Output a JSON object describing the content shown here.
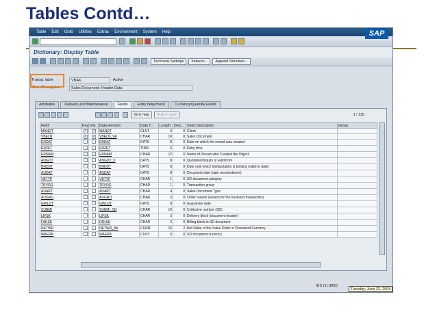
{
  "slide": {
    "title": "Tables Contd…"
  },
  "menubar": {
    "items": [
      "Table",
      "Edit",
      "Goto",
      "Utilities",
      "Extras",
      "Environment",
      "System",
      "Help"
    ],
    "logo": "SAP"
  },
  "titlebar": {
    "title": "Dictionary: Display Table"
  },
  "toolbar2": {
    "technical_settings": "Technical Settings",
    "indexes": "Indexes...",
    "append_structure": "Append Structure..."
  },
  "header": {
    "table_label": "Transp. table",
    "table_value": "VBAK",
    "status": "Active",
    "desc_label": "Short Description",
    "desc_value": "Sales Document: Header Data"
  },
  "tabs": [
    "Attributes",
    "Delivery and Maintenance",
    "Fields",
    "Entry help/check",
    "Currency/Quantity Fields"
  ],
  "active_tab": "Fields",
  "panel_toolbar": {
    "srch_help": "Srch help",
    "built_in_type": "Built-in type",
    "counter": "1 / 115"
  },
  "columns": [
    "Field",
    "Key",
    "Initi..",
    "Data element",
    "Data T...",
    "Length",
    "Deci...",
    "Short Description",
    "Group"
  ],
  "rows": [
    {
      "field": "MANDT",
      "key": true,
      "init": true,
      "de": "MANDT",
      "dtype": "CLNT",
      "len": "3",
      "dec": "0",
      "desc": "Client"
    },
    {
      "field": "VBELN",
      "key": true,
      "init": true,
      "de": "VBELN_VA",
      "dtype": "CHAR",
      "len": "10",
      "dec": "0",
      "desc": "Sales Document"
    },
    {
      "field": "ERDAT",
      "key": false,
      "init": false,
      "de": "ERDAT",
      "dtype": "DATS",
      "len": "8",
      "dec": "0",
      "desc": "Date on which the record was created"
    },
    {
      "field": "ERZET",
      "key": false,
      "init": false,
      "de": "ERZET",
      "dtype": "TIMS",
      "len": "6",
      "dec": "0",
      "desc": "Entry time"
    },
    {
      "field": "ERNAM",
      "key": false,
      "init": false,
      "de": "ERNAM",
      "dtype": "CHAR",
      "len": "12",
      "dec": "0",
      "desc": "Name of Person who Created the Object"
    },
    {
      "field": "ANGDT",
      "key": false,
      "init": false,
      "de": "ANGDT_V",
      "dtype": "DATS",
      "len": "8",
      "dec": "0",
      "desc": "Quotation/Inquiry is valid from"
    },
    {
      "field": "BNDDT",
      "key": false,
      "init": false,
      "de": "BNDDT",
      "dtype": "DATS",
      "len": "8",
      "dec": "0",
      "desc": "Date until which bid/quotation is binding (valid-to date)"
    },
    {
      "field": "AUDAT",
      "key": false,
      "init": false,
      "de": "AUDAT",
      "dtype": "DATS",
      "len": "8",
      "dec": "0",
      "desc": "Document date (date received/sent)"
    },
    {
      "field": "VBTYP",
      "key": false,
      "init": false,
      "de": "VBTYP",
      "dtype": "CHAR",
      "len": "1",
      "dec": "0",
      "desc": "SD document category"
    },
    {
      "field": "TRVOG",
      "key": false,
      "init": false,
      "de": "TRVOG",
      "dtype": "CHAR",
      "len": "1",
      "dec": "0",
      "desc": "Transaction group"
    },
    {
      "field": "AUART",
      "key": false,
      "init": false,
      "de": "AUART",
      "dtype": "CHAR",
      "len": "4",
      "dec": "0",
      "desc": "Sales Document Type"
    },
    {
      "field": "AUGRU",
      "key": false,
      "init": false,
      "de": "AUGRU",
      "dtype": "CHAR",
      "len": "3",
      "dec": "0",
      "desc": "Order reason (reason for the business transaction)"
    },
    {
      "field": "GWLDT",
      "key": false,
      "init": false,
      "de": "GWLDT",
      "dtype": "DATS",
      "len": "8",
      "dec": "0",
      "desc": "Guarantee date"
    },
    {
      "field": "SUBMI",
      "key": false,
      "init": false,
      "de": "SUBMI_SD",
      "dtype": "CHAR",
      "len": "10",
      "dec": "0",
      "desc": "Collective number (SD)"
    },
    {
      "field": "LIFSK",
      "key": false,
      "init": false,
      "de": "LIFSK",
      "dtype": "CHAR",
      "len": "2",
      "dec": "0",
      "desc": "Delivery block (document header)"
    },
    {
      "field": "FAKSK",
      "key": false,
      "init": false,
      "de": "FAKSK",
      "dtype": "CHAR",
      "len": "2",
      "dec": "0",
      "desc": "Billing block in SD document"
    },
    {
      "field": "NETWR",
      "key": false,
      "init": false,
      "de": "NETWR_AK",
      "dtype": "CURR",
      "len": "15",
      "dec": "2",
      "desc": "Net Value of the Sales Order in Document Currency"
    },
    {
      "field": "WAERK",
      "key": false,
      "init": false,
      "de": "WAERK",
      "dtype": "CUKY",
      "len": "5",
      "dec": "0",
      "desc": "SD document currency"
    }
  ],
  "status_bar": {
    "system": "IDS (1) (800)",
    "date": "Tuesday, June 22, 2004"
  }
}
